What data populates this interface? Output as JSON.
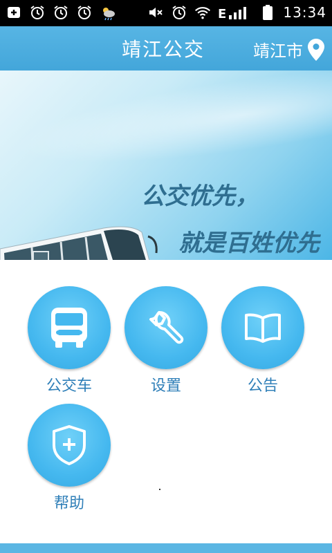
{
  "status_bar": {
    "time": "13:34",
    "network": "E",
    "left_icons": [
      "add-notification-icon",
      "alarm-icon",
      "alarm-icon",
      "alarm-icon",
      "weather-icon"
    ],
    "right_icons": [
      "mute-icon",
      "alarm-icon",
      "wifi-icon",
      "signal-icon",
      "battery-icon"
    ]
  },
  "header": {
    "title": "靖江公交",
    "city": "靖江市",
    "location_icon": "location-pin-icon",
    "bg_color": "#4aaee0"
  },
  "banner": {
    "slogan_line1": "公交优先，",
    "slogan_line2": "就是百姓优先",
    "image": "bus-photo",
    "page_indicator_total": 1,
    "page_indicator_active": 1
  },
  "menu": {
    "items": [
      {
        "label": "公交车",
        "icon": "bus-icon"
      },
      {
        "label": "设置",
        "icon": "wrench-icon"
      },
      {
        "label": "公告",
        "icon": "book-icon"
      },
      {
        "label": "帮助",
        "icon": "shield-plus-icon"
      }
    ],
    "circle_color": "#45b8ef",
    "label_color": "#2f7fb8"
  }
}
